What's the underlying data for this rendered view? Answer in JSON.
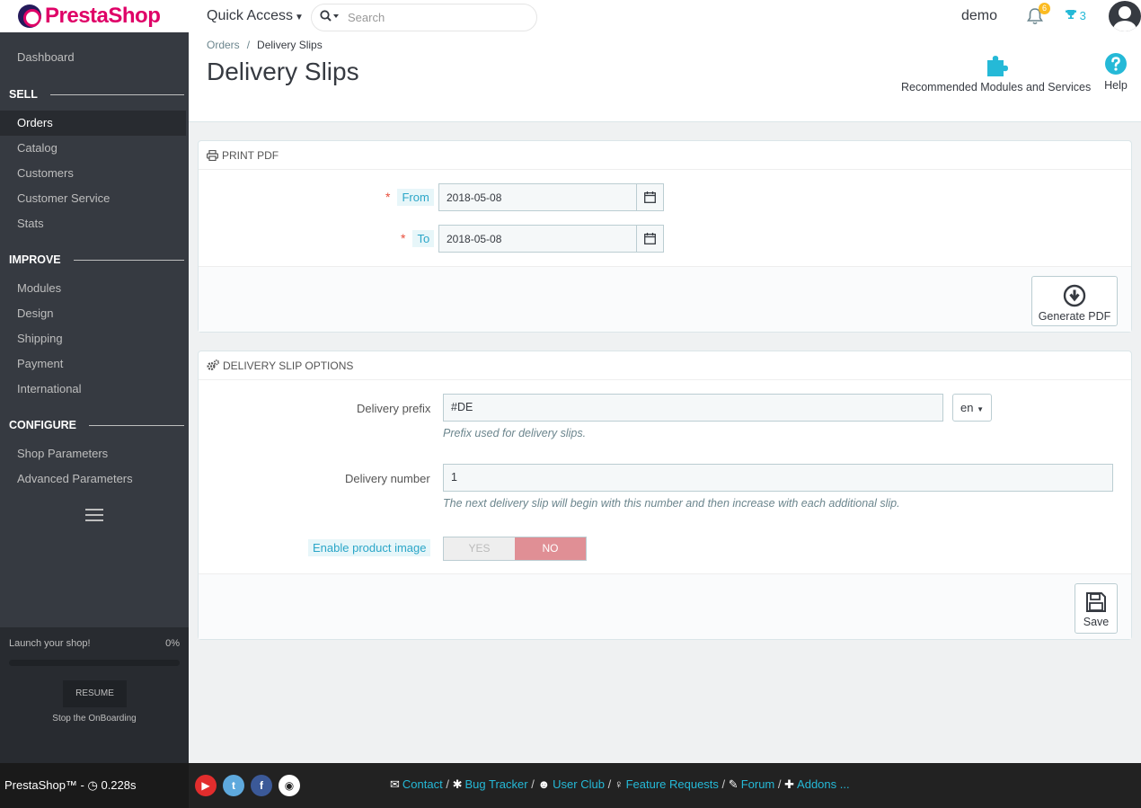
{
  "header": {
    "logo_text": "PrestaShop",
    "quick_access_label": "Quick Access",
    "search_placeholder": "Search",
    "employee_name": "demo",
    "notifications_count": "6",
    "trophy_count": "3"
  },
  "sidebar": {
    "dashboard": "Dashboard",
    "sections": [
      {
        "title": "SELL",
        "items": [
          "Orders",
          "Catalog",
          "Customers",
          "Customer Service",
          "Stats"
        ]
      },
      {
        "title": "IMPROVE",
        "items": [
          "Modules",
          "Design",
          "Shipping",
          "Payment",
          "International"
        ]
      },
      {
        "title": "CONFIGURE",
        "items": [
          "Shop Parameters",
          "Advanced Parameters"
        ]
      }
    ],
    "active_item": "Orders",
    "onboarding": {
      "label": "Launch your shop!",
      "percent": "0%",
      "progress": 0,
      "resume_label": "RESUME",
      "stop_label": "Stop the OnBoarding"
    }
  },
  "page": {
    "breadcrumb": [
      "Orders",
      "Delivery Slips"
    ],
    "title": "Delivery Slips",
    "toolbar": {
      "recommended_label": "Recommended Modules and Services",
      "help_label": "Help"
    }
  },
  "print_pdf": {
    "title": "PRINT PDF",
    "from_label": "From",
    "from_value": "2018-05-08",
    "to_label": "To",
    "to_value": "2018-05-08",
    "required_mark": "*",
    "generate_label": "Generate PDF"
  },
  "options": {
    "title": "DELIVERY SLIP OPTIONS",
    "prefix_label": "Delivery prefix",
    "prefix_value": "#DE",
    "prefix_lang": "en",
    "prefix_help": "Prefix used for delivery slips.",
    "number_label": "Delivery number",
    "number_value": "1",
    "number_help": "The next delivery slip will begin with this number and then increase with each additional slip.",
    "product_image_label": "Enable product image",
    "yes_label": "YES",
    "no_label": "NO",
    "product_image_enabled": false,
    "save_label": "Save"
  },
  "footer": {
    "version_text": "PrestaShop™ - ",
    "load_time": "0.228s",
    "links": [
      "Contact",
      "Bug Tracker",
      "User Club",
      "Feature Requests",
      "Forum",
      "Addons ..."
    ],
    "link_separator": "/"
  },
  "colors": {
    "brand_pink": "#df0067",
    "accent_blue": "#25b9d7",
    "sidebar_bg": "#363a41",
    "badge_yellow": "#fbbb22",
    "switch_no": "#e08f95"
  }
}
